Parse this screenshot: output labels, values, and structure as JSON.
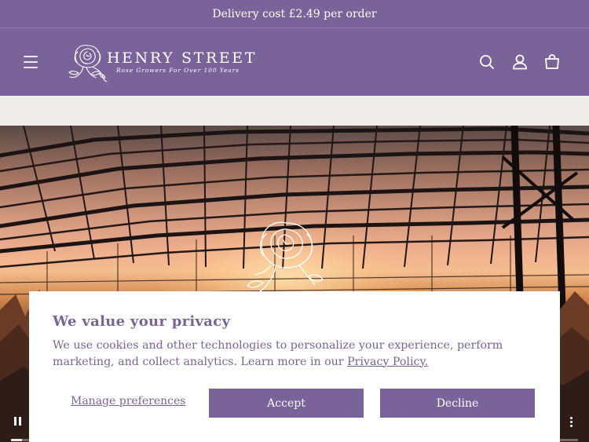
{
  "announcement": {
    "text": "Delivery cost £2.49 per order"
  },
  "header": {
    "brand_name": "HENRY STREET",
    "tagline": "Rose Growers For Over 100 Years",
    "icons": {
      "menu": "hamburger-menu-icon",
      "search": "search-icon",
      "account": "account-icon",
      "cart": "cart-icon"
    }
  },
  "hero": {
    "video_progress": 0.02,
    "controls": {
      "pause": "pause-icon",
      "more": "more-options-icon"
    }
  },
  "consent": {
    "title": "We value your privacy",
    "body": "We use cookies and other technologies to personalize your experience, perform marketing, and collect analytics. Learn more in our",
    "policy_link": "Privacy Policy.",
    "manage_label": "Manage preferences",
    "accept_label": "Accept",
    "decline_label": "Decline"
  },
  "colors": {
    "brand": "#7a6398",
    "strip": "#efedea",
    "dialog": "#ffffff"
  }
}
